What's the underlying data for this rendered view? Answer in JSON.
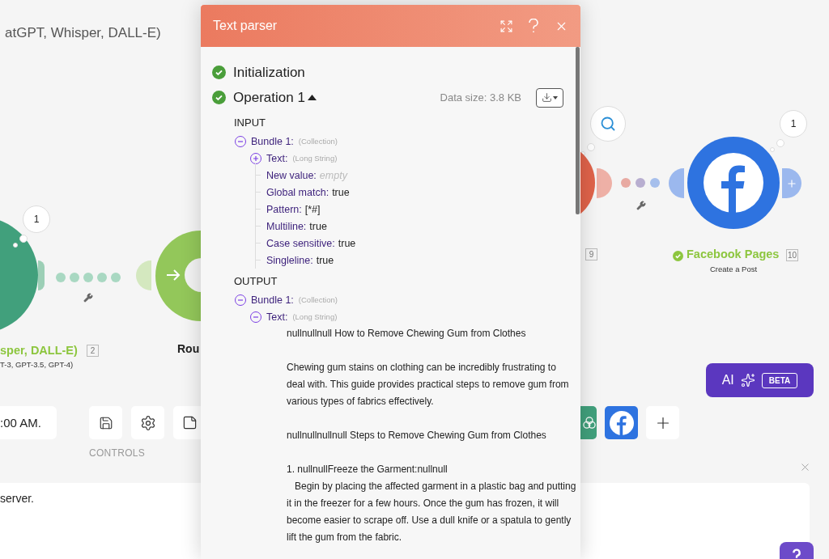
{
  "canvas": {
    "scenario_title": "atGPT, Whisper, DALL-E)",
    "modules": [
      {
        "kind": "openai",
        "badge": "1",
        "name": "sper, DALL-E)",
        "subtitle": "T-3, GPT-3.5, GPT-4)",
        "number": "2"
      },
      {
        "kind": "router",
        "name": "Rou"
      },
      {
        "kind": "red",
        "number": "9"
      },
      {
        "kind": "facebook",
        "badge": "1",
        "name": "Facebook Pages",
        "subtitle": "Create a Post",
        "number": "10",
        "success": true
      }
    ],
    "ai_button": {
      "label": "AI",
      "badge": "BETA"
    }
  },
  "toolbar": {
    "time_value": ":00 AM.",
    "controls_label": "CONTROLS",
    "controls": [
      {
        "kind": "save"
      },
      {
        "kind": "settings"
      },
      {
        "kind": "note"
      }
    ],
    "favorites": [
      {
        "kind": "openai"
      },
      {
        "kind": "facebook"
      },
      {
        "kind": "add"
      }
    ]
  },
  "log_panel": {
    "message": "server."
  },
  "dialog": {
    "title": "Text parser",
    "operations": [
      {
        "label": "Initialization",
        "success": true
      },
      {
        "label": "Operation 1",
        "success": true,
        "expanded": true,
        "data_size": "Data size: 3.8 KB",
        "sections": [
          {
            "heading": "INPUT",
            "tree": [
              {
                "kind": "collection",
                "key": "Bundle 1:",
                "type": "(Collection)",
                "expanded": true,
                "children": [
                  {
                    "kind": "collection",
                    "key": "Text:",
                    "type": "(Long String)",
                    "expanded": false
                  },
                  {
                    "kind": "value",
                    "key": "New value:",
                    "value": "empty",
                    "empty": true
                  },
                  {
                    "kind": "value",
                    "key": "Global match:",
                    "value": "true",
                    "empty": false
                  },
                  {
                    "kind": "value",
                    "key": "Pattern:",
                    "value": "[*#]",
                    "empty": false
                  },
                  {
                    "kind": "value",
                    "key": "Multiline:",
                    "value": "true",
                    "empty": false
                  },
                  {
                    "kind": "value",
                    "key": "Case sensitive:",
                    "value": "true",
                    "empty": false
                  },
                  {
                    "kind": "value",
                    "key": "Singleline:",
                    "value": "true",
                    "empty": false
                  }
                ]
              }
            ]
          },
          {
            "heading": "OUTPUT",
            "tree": [
              {
                "kind": "collection",
                "key": "Bundle 1:",
                "type": "(Collection)",
                "expanded": true,
                "children": [
                  {
                    "kind": "collection",
                    "key": "Text:",
                    "type": "(Long String)",
                    "expanded": true,
                    "children": [
                      {
                        "kind": "paragraph",
                        "text": "nullnullnull How to Remove Chewing Gum from Clothes"
                      },
                      {
                        "kind": "paragraph",
                        "text": "Chewing gum stains on clothing can be incredibly frustrating to deal with. This guide provides practical steps to remove gum from various types of fabrics effectively."
                      },
                      {
                        "kind": "paragraph",
                        "text": "nullnullnullnull Steps to Remove Chewing Gum from Clothes"
                      },
                      {
                        "kind": "paragraph",
                        "text": "1. nullnullFreeze the Garment:nullnull\n   Begin by placing the affected garment in a plastic bag and putting it in the freezer for a few hours. Once the gum has frozen, it will become easier to scrape off. Use a dull knife or a spatula to gently lift the gum from the fabric."
                      }
                    ]
                  }
                ]
              }
            ]
          }
        ]
      }
    ]
  }
}
